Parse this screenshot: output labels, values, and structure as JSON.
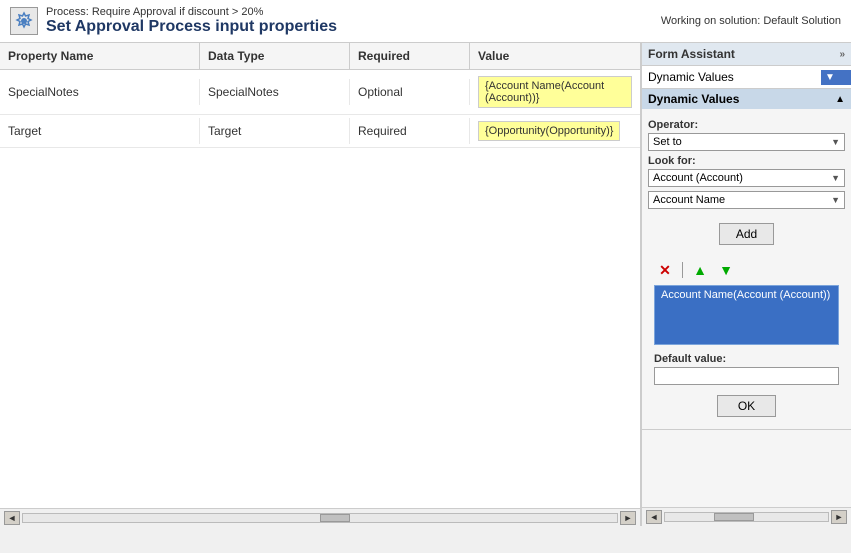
{
  "topbar": {
    "process_subtitle": "Process: Require Approval if discount > 20%",
    "main_title": "Set Approval Process input properties",
    "working_on": "Working on solution: Default Solution"
  },
  "table": {
    "headers": [
      "Property Name",
      "Data Type",
      "Required",
      "Value"
    ],
    "rows": [
      {
        "property_name": "SpecialNotes",
        "data_type": "SpecialNotes",
        "required": "Optional",
        "value": "{Account Name(Account (Account))}"
      },
      {
        "property_name": "Target",
        "data_type": "Target",
        "required": "Required",
        "value": "{Opportunity(Opportunity)}"
      }
    ]
  },
  "form_assistant": {
    "title": "Form Assistant",
    "chevron": "»",
    "dynamic_values_dropdown": "Dynamic Values",
    "dynamic_values_section_label": "Dynamic Values",
    "operator_label": "Operator:",
    "operator_value": "Set to",
    "look_for_label": "Look for:",
    "look_for_value": "Account (Account)",
    "field_value": "Account Name",
    "add_button": "Add",
    "selected_item": "Account Name(Account (Account))",
    "default_value_label": "Default value:",
    "default_value_placeholder": "",
    "ok_button": "OK",
    "scroll_left": "◄",
    "scroll_right": "►"
  },
  "bottom_scroll": {
    "left": "◄",
    "right": "►"
  }
}
